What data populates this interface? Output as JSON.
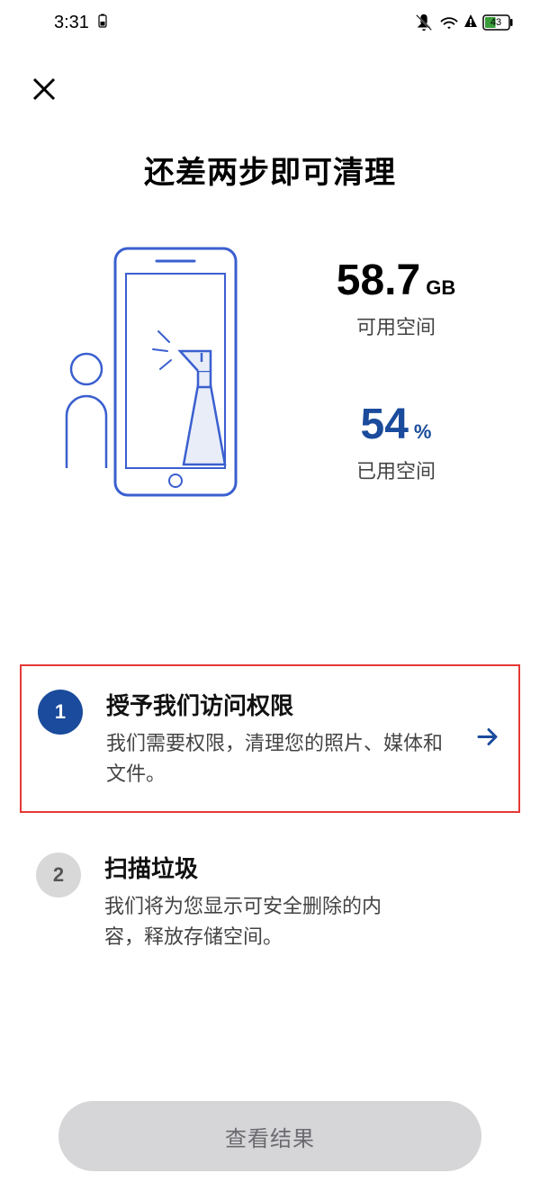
{
  "statusBar": {
    "time": "3:31",
    "battery": "43"
  },
  "header": {
    "title": "还差两步即可清理"
  },
  "storage": {
    "free": {
      "value": "58.7",
      "unit": "GB",
      "label": "可用空间"
    },
    "used": {
      "value": "54",
      "unit": "%",
      "label": "已用空间"
    }
  },
  "steps": [
    {
      "num": "1",
      "title": "授予我们访问权限",
      "desc": "我们需要权限，清理您的照片、媒体和文件。",
      "active": true,
      "hasArrow": true
    },
    {
      "num": "2",
      "title": "扫描垃圾",
      "desc": "我们将为您显示可安全删除的内容，释放存储空间。",
      "active": false,
      "hasArrow": false
    }
  ],
  "footer": {
    "resultButton": "查看结果"
  }
}
